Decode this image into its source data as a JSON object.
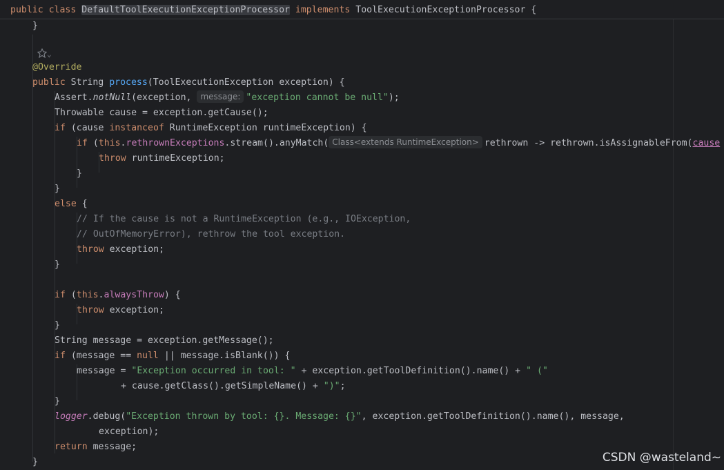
{
  "header": {
    "public": "public",
    "class": "class",
    "class_name": "DefaultToolExecutionExceptionProcessor",
    "implements": "implements",
    "interface": "ToolExecutionExceptionProcessor",
    "brace": "{"
  },
  "code": {
    "close_prev": "}",
    "annotation": "@Override",
    "sig_public": "public",
    "sig_type": "String",
    "sig_method": "process",
    "sig_params": "(ToolExecutionException exception) {",
    "l4_a": "Assert.",
    "l4_b": "notNull",
    "l4_c": "(exception, ",
    "l4_hint": "message:",
    "l4_str": "\"exception cannot be null\"",
    "l4_d": ");",
    "l5": "Throwable cause = exception.getCause();",
    "l6_if": "if",
    "l6_a": " (cause ",
    "l6_instanceof": "instanceof",
    "l6_b": " RuntimeException runtimeException) {",
    "l7_if": "if",
    "l7_a": " (",
    "l7_this": "this",
    "l7_dot": ".",
    "l7_field": "rethrownExceptions",
    "l7_b": ".stream().anyMatch(",
    "l7_hint": "Class<extends RuntimeException>",
    "l7_c": "rethrown -> rethrown.isAssignableFrom(",
    "l7_cause": "cause",
    "l8_throw": "throw",
    "l8_a": " runtimeException;",
    "l9": "}",
    "l10": "}",
    "l11_else": "else",
    "l11_a": " {",
    "l12": "// If the cause is not a RuntimeException (e.g., IOException,",
    "l13": "// OutOfMemoryError), rethrow the tool exception.",
    "l14_throw": "throw",
    "l14_a": " exception;",
    "l15": "}",
    "l16_if": "if",
    "l16_a": " (",
    "l16_this": "this",
    "l16_dot": ".",
    "l16_field": "alwaysThrow",
    "l16_b": ") {",
    "l17_throw": "throw",
    "l17_a": " exception;",
    "l18": "}",
    "l19": "String message = exception.getMessage();",
    "l20_if": "if",
    "l20_a": " (message == ",
    "l20_null": "null",
    "l20_b": " || message.isBlank()) {",
    "l21_a": "message = ",
    "l21_str1": "\"Exception occurred in tool: \"",
    "l21_b": " + exception.getToolDefinition().name() + ",
    "l21_str2": "\" (\"",
    "l22_a": "+ cause.getClass().getSimpleName() + ",
    "l22_str": "\")\"",
    "l22_b": ";",
    "l23": "}",
    "l24_logger": "logger",
    "l24_a": ".debug(",
    "l24_str": "\"Exception thrown by tool: {}. Message: {}\"",
    "l24_b": ", exception.getToolDefinition().name(), message,",
    "l25": "exception);",
    "l26_return": "return",
    "l26_a": " message;",
    "l27": "}"
  },
  "watermark": "CSDN @wasteland~",
  "colors": {
    "background": "#1e1f22",
    "keyword": "#cf8e6d",
    "annotation": "#b3ae60",
    "method": "#56a8f5",
    "string": "#6aab73",
    "field": "#c77dbb",
    "comment": "#7a7e85",
    "text": "#bcbec4"
  },
  "icons": {
    "gutter": "ai-assist-icon"
  }
}
